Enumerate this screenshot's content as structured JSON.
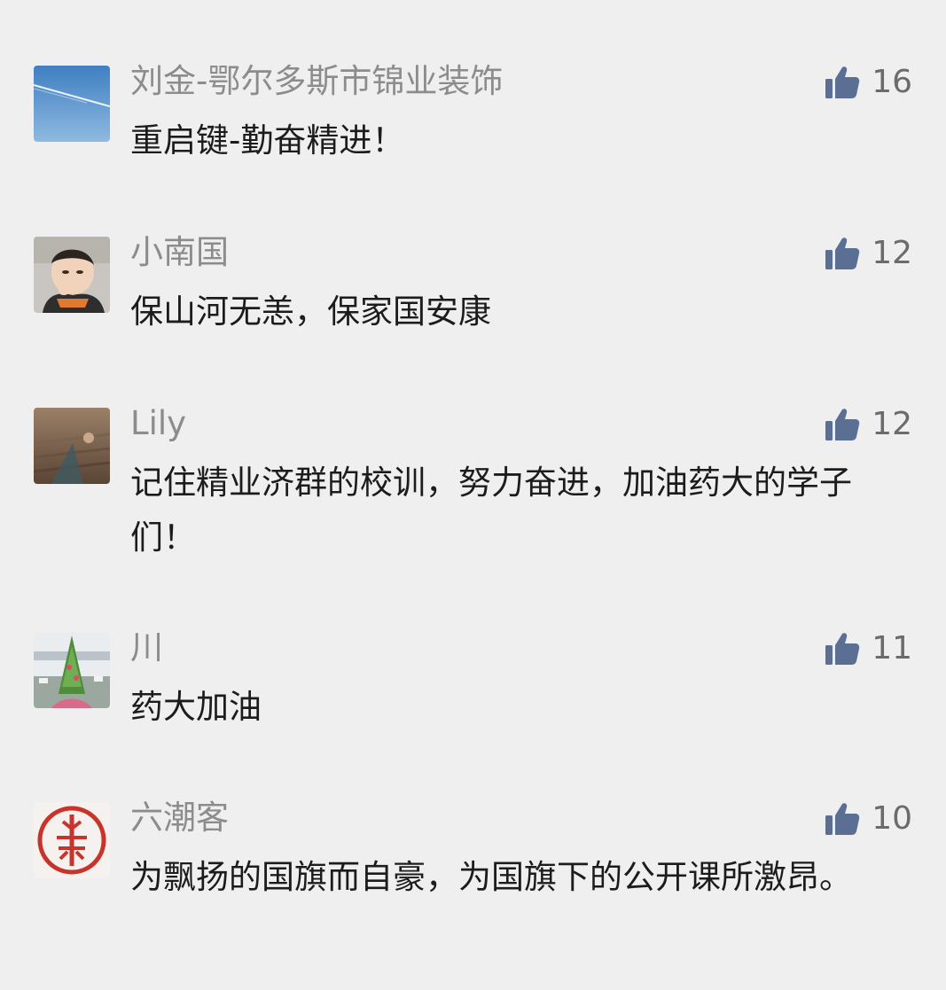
{
  "comments": [
    {
      "nickname": "刘金-鄂尔多斯市锦业装饰",
      "content": "重启键-勤奋精进！",
      "likes": "16",
      "accent": "#5b8fc6"
    },
    {
      "nickname": "小南国",
      "content": "保山河无恙，保家国安康",
      "likes": "12",
      "accent": "#d8b59a"
    },
    {
      "nickname": "Lily",
      "content": "记住精业济群的校训，努力奋进，加油药大的学子们！",
      "likes": "12",
      "accent": "#6f5a48"
    },
    {
      "nickname": "川",
      "content": "药大加油",
      "likes": "11",
      "accent": "#5e9a4a"
    },
    {
      "nickname": "六潮客",
      "content": "为飘扬的国旗而自豪，为国旗下的公开课所激昂。",
      "likes": "10",
      "accent": "#c8332c"
    }
  ],
  "icons": {
    "like": "thumbs-up-icon"
  },
  "colors": {
    "like_icon": "#5b6f95",
    "nickname": "#8c8c8c",
    "content": "#1c1c1c",
    "background": "#efefef"
  }
}
